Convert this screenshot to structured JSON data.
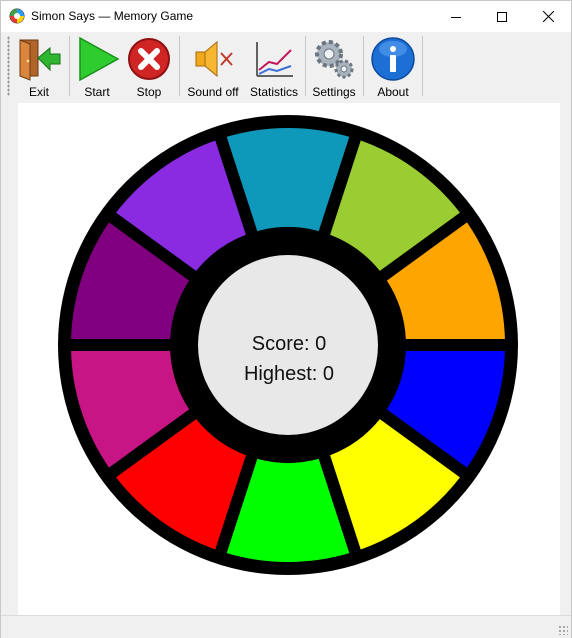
{
  "window": {
    "title": "Simon Says — Memory Game"
  },
  "toolbar": {
    "exit_label": "Exit",
    "start_label": "Start",
    "stop_label": "Stop",
    "sound_label": "Sound off",
    "statistics_label": "Statistics",
    "settings_label": "Settings",
    "about_label": "About"
  },
  "game": {
    "score_text": "Score: 0",
    "highest_text": "Highest: 0",
    "segments": [
      {
        "name": "teal",
        "color": "#0e98ba"
      },
      {
        "name": "yellow-green",
        "color": "#9acd32"
      },
      {
        "name": "orange",
        "color": "#ffa500"
      },
      {
        "name": "blue",
        "color": "#0000ff"
      },
      {
        "name": "yellow",
        "color": "#ffff00"
      },
      {
        "name": "lime",
        "color": "#00ff00"
      },
      {
        "name": "red",
        "color": "#ff0000"
      },
      {
        "name": "magenta",
        "color": "#c71585"
      },
      {
        "name": "purple",
        "color": "#800080"
      },
      {
        "name": "violet",
        "color": "#8a2be2"
      }
    ]
  }
}
